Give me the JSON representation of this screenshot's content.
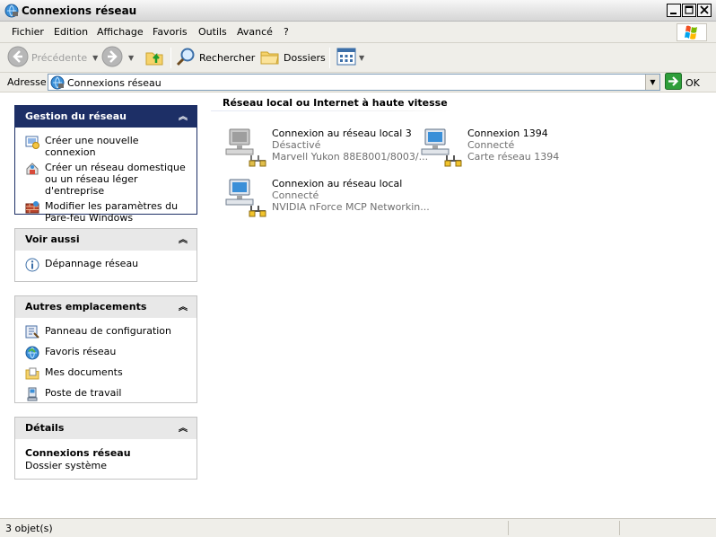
{
  "window": {
    "title": "Connexions réseau",
    "icon": "network-connections-icon"
  },
  "menu": {
    "items": [
      "Fichier",
      "Edition",
      "Affichage",
      "Favoris",
      "Outils",
      "Avancé",
      "?"
    ]
  },
  "toolbar": {
    "back_label": "Précédente",
    "search_label": "Rechercher",
    "folders_label": "Dossiers"
  },
  "address": {
    "label": "Adresse",
    "value": "Connexions réseau",
    "go_label": "OK"
  },
  "panels": {
    "network_tasks": {
      "title": "Gestion du réseau",
      "items": [
        {
          "label": "Créer une nouvelle connexion",
          "icon": "new-connection-icon"
        },
        {
          "label": "Créer un réseau domestique\nou un réseau léger d'entreprise",
          "icon": "home-network-icon"
        },
        {
          "label": "Modifier les paramètres du\nPare-feu Windows",
          "icon": "firewall-icon"
        }
      ]
    },
    "see_also": {
      "title": "Voir aussi",
      "items": [
        {
          "label": "Dépannage réseau",
          "icon": "info-icon"
        }
      ]
    },
    "other_places": {
      "title": "Autres emplacements",
      "items": [
        {
          "label": "Panneau de configuration",
          "icon": "control-panel-icon"
        },
        {
          "label": "Favoris réseau",
          "icon": "network-places-icon"
        },
        {
          "label": "Mes documents",
          "icon": "documents-folder-icon"
        },
        {
          "label": "Poste de travail",
          "icon": "my-computer-icon"
        }
      ]
    },
    "details": {
      "title": "Détails",
      "name": "Connexions réseau",
      "type": "Dossier système"
    }
  },
  "group": {
    "title": "Réseau local ou Internet à haute vitesse"
  },
  "connections": [
    {
      "name": "Connexion au réseau local 3",
      "status": "Désactivé",
      "device": "Marvell Yukon 88E8001/8003/...",
      "enabled": false
    },
    {
      "name": "Connexion 1394",
      "status": "Connecté",
      "device": "Carte réseau 1394",
      "enabled": true
    },
    {
      "name": "Connexion au réseau local",
      "status": "Connecté",
      "device": "NVIDIA nForce MCP Networkin...",
      "enabled": true
    }
  ],
  "statusbar": {
    "text": "3 objet(s)"
  },
  "colors": {
    "primary_panel": "#1d2f66",
    "panel_head": "#e8e8e8",
    "chrome": "#efeee9",
    "go_green": "#2e9e3a",
    "muted_text": "#6f6f6f"
  }
}
